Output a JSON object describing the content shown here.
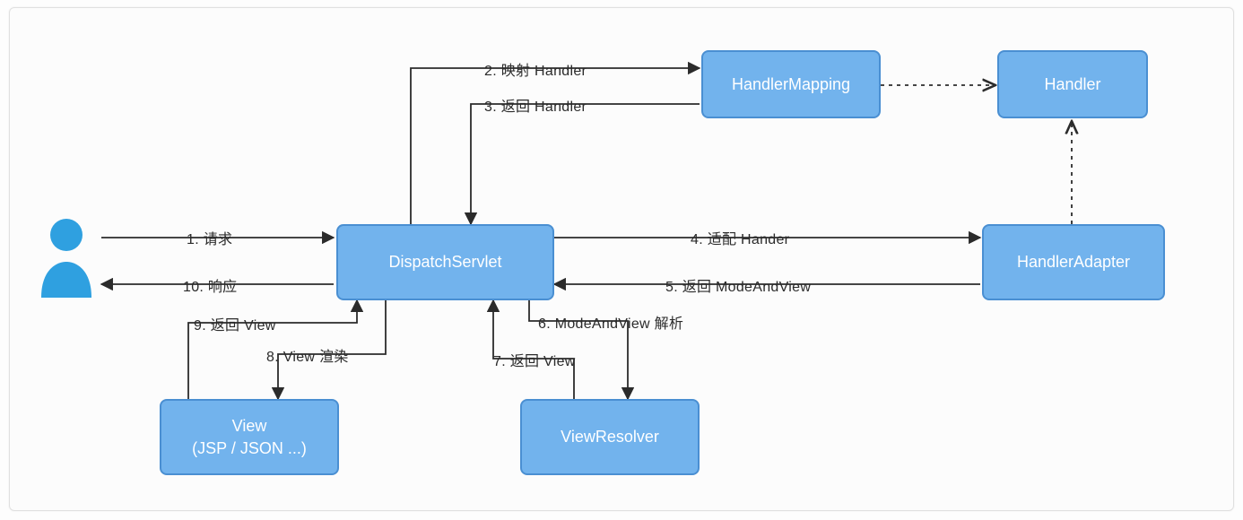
{
  "nodes": {
    "dispatch_servlet": "DispatchServlet",
    "handler_mapping": "HandlerMapping",
    "handler": "Handler",
    "handler_adapter": "HandlerAdapter",
    "view_resolver": "ViewResolver",
    "view_line1": "View",
    "view_line2": "(JSP / JSON ...)"
  },
  "labels": {
    "l1": "1. 请求",
    "l2": "2. 映射 Handler",
    "l3": "3. 返回 Handler",
    "l4": "4. 适配 Hander",
    "l5": "5. 返回 ModeAndView",
    "l6": "6. ModeAndView 解析",
    "l7": "7. 返回 View",
    "l8": "8. View 渲染",
    "l9": "9. 返回 View",
    "l10": "10. 响应"
  }
}
